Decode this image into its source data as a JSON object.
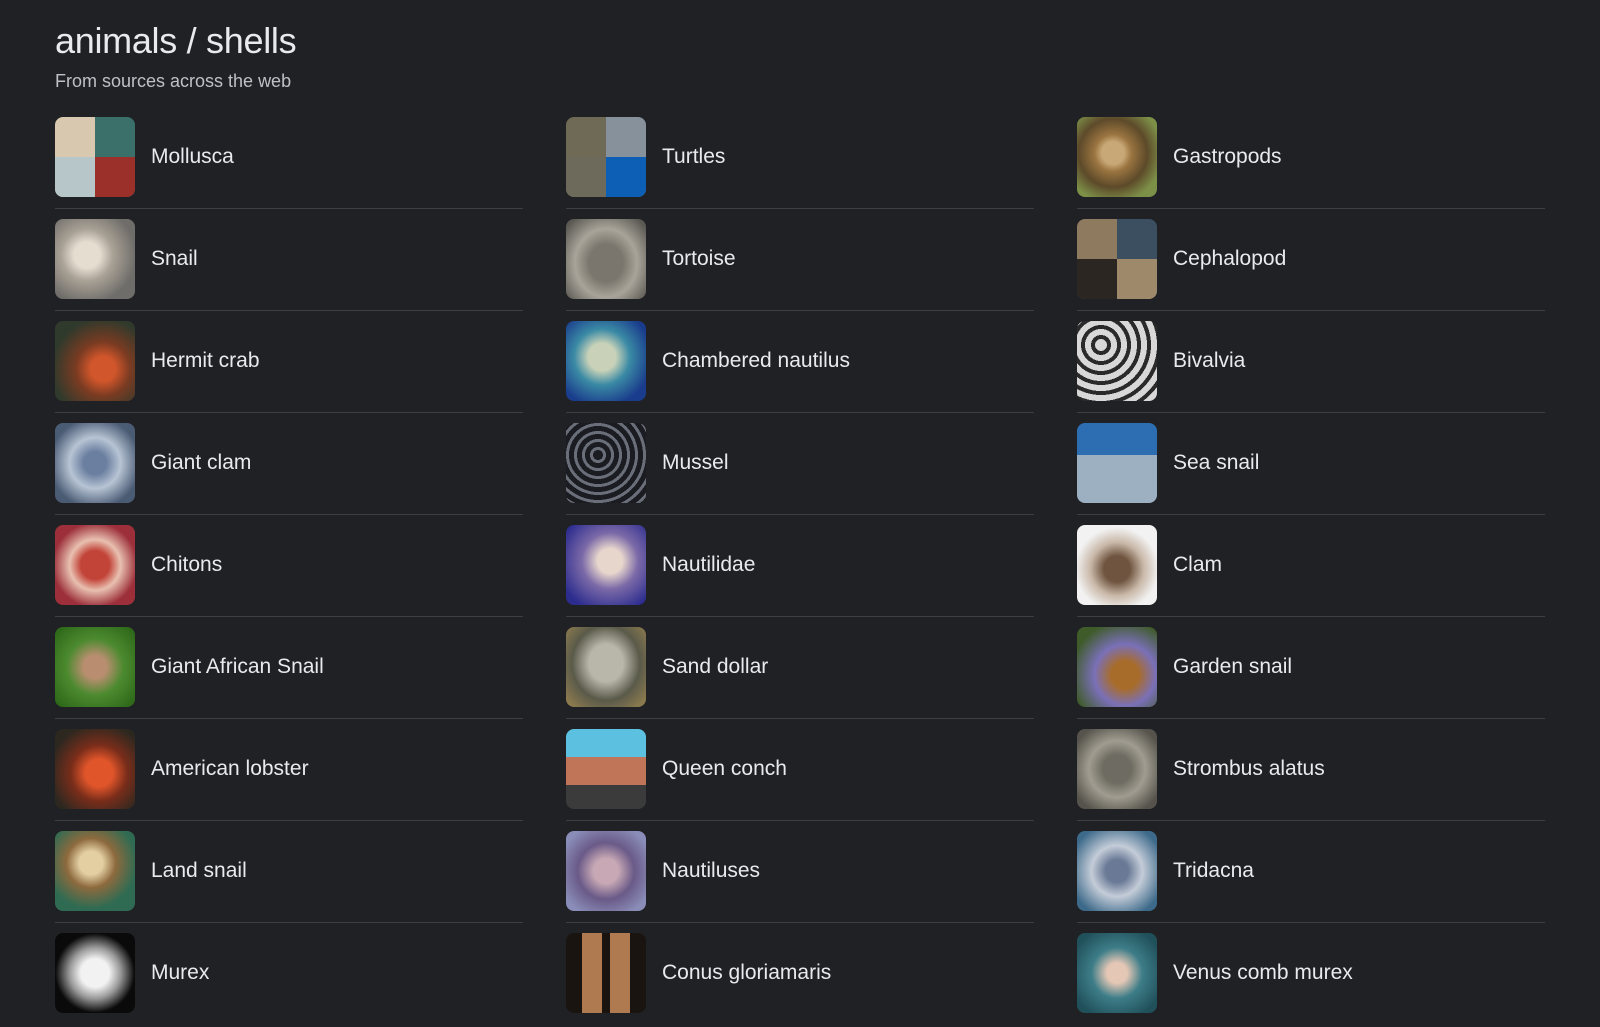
{
  "header": {
    "title": "animals / shells",
    "subtitle": "From sources across the web"
  },
  "columns": [
    {
      "items": [
        {
          "label": "Mollusca",
          "thumb": "t-mollusca"
        },
        {
          "label": "Snail",
          "thumb": "t-snail"
        },
        {
          "label": "Hermit crab",
          "thumb": "t-hermit"
        },
        {
          "label": "Giant clam",
          "thumb": "t-gclam"
        },
        {
          "label": "Chitons",
          "thumb": "t-chitons"
        },
        {
          "label": "Giant African Snail",
          "thumb": "t-gafrican"
        },
        {
          "label": "American lobster",
          "thumb": "t-lobster"
        },
        {
          "label": "Land snail",
          "thumb": "t-landsnail"
        },
        {
          "label": "Murex",
          "thumb": "t-murex"
        }
      ]
    },
    {
      "items": [
        {
          "label": "Turtles",
          "thumb": "t-turtles"
        },
        {
          "label": "Tortoise",
          "thumb": "t-tortoise"
        },
        {
          "label": "Chambered nautilus",
          "thumb": "t-nautilus"
        },
        {
          "label": "Mussel",
          "thumb": "t-mussel"
        },
        {
          "label": "Nautilidae",
          "thumb": "t-nautilidae"
        },
        {
          "label": "Sand dollar",
          "thumb": "t-sanddollar"
        },
        {
          "label": "Queen conch",
          "thumb": "t-conch"
        },
        {
          "label": "Nautiluses",
          "thumb": "t-nautiluses"
        },
        {
          "label": "Conus gloriamaris",
          "thumb": "t-conus"
        }
      ]
    },
    {
      "items": [
        {
          "label": "Gastropods",
          "thumb": "t-gastro"
        },
        {
          "label": "Cephalopod",
          "thumb": "t-cephalo"
        },
        {
          "label": "Bivalvia",
          "thumb": "t-bivalvia"
        },
        {
          "label": "Sea snail",
          "thumb": "t-seasnail"
        },
        {
          "label": "Clam",
          "thumb": "t-clam"
        },
        {
          "label": "Garden snail",
          "thumb": "t-gardensnail"
        },
        {
          "label": "Strombus alatus",
          "thumb": "t-strombus"
        },
        {
          "label": "Tridacna",
          "thumb": "t-tridacna"
        },
        {
          "label": "Venus comb murex",
          "thumb": "t-venus"
        }
      ]
    }
  ]
}
